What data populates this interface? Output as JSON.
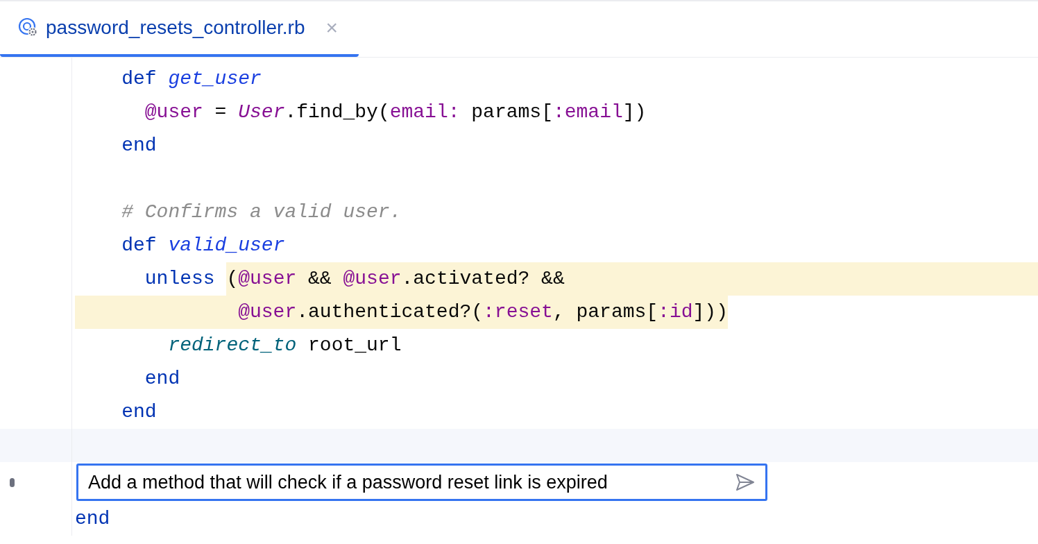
{
  "tabs": [
    {
      "label": "password_resets_controller.rb",
      "selected": true,
      "close": "×"
    }
  ],
  "code": [
    {
      "kind": "line",
      "tokens": [
        {
          "kind": "keyword",
          "text": "def "
        },
        {
          "kind": "method_name",
          "text": "get_user"
        }
      ],
      "children": [
        {
          "kind": "line",
          "tokens": [
            {
              "kind": "ivar",
              "text": "@user"
            },
            {
              "kind": "plain",
              "text": " = "
            },
            {
              "kind": "constant",
              "text": "User"
            },
            {
              "kind": "plain",
              "text": ".find_by("
            },
            {
              "kind": "symbol",
              "text": "email:"
            },
            {
              "kind": "plain",
              "text": " params["
            },
            {
              "kind": "symbol",
              "text": ":email"
            },
            {
              "kind": "plain",
              "text": "])"
            }
          ]
        }
      ]
    },
    {
      "kind": "line",
      "tokens": [
        {
          "kind": "keyword",
          "text": "end"
        }
      ]
    },
    {
      "kind": "blank"
    },
    {
      "kind": "line",
      "tokens": [
        {
          "kind": "comment",
          "text": "# Confirms a valid user."
        }
      ]
    },
    {
      "kind": "line",
      "tokens": [
        {
          "kind": "keyword",
          "text": "def "
        },
        {
          "kind": "method_name",
          "text": "valid_user"
        }
      ],
      "children": [
        {
          "kind": "line",
          "highlight_to_end": true,
          "tokens": [
            {
              "kind": "keyword",
              "text": "unless "
            },
            {
              "kind": "plain",
              "text": "(",
              "highlighted": true
            },
            {
              "kind": "ivar",
              "text": "@user",
              "highlighted": true
            },
            {
              "kind": "plain",
              "text": " && ",
              "highlighted": true
            },
            {
              "kind": "ivar",
              "text": "@user",
              "highlighted": true
            },
            {
              "kind": "plain",
              "text": ".activated? &&",
              "highlighted": true
            }
          ],
          "continuation": {
            "highlighted": true,
            "tokens": [
              {
                "kind": "ivar",
                "text": "@user"
              },
              {
                "kind": "plain",
                "text": ".authenticated?("
              },
              {
                "kind": "symbol",
                "text": ":reset"
              },
              {
                "kind": "plain",
                "text": ", params["
              },
              {
                "kind": "symbol",
                "text": ":id"
              },
              {
                "kind": "plain",
                "text": "]))"
              }
            ]
          },
          "children": [
            {
              "kind": "line",
              "tokens": [
                {
                  "kind": "call",
                  "text": "redirect_to"
                },
                {
                  "kind": "plain",
                  "text": " root_url"
                }
              ]
            }
          ]
        },
        {
          "kind": "line",
          "tokens": [
            {
              "kind": "keyword",
              "text": "end"
            }
          ]
        }
      ]
    },
    {
      "kind": "line",
      "tokens": [
        {
          "kind": "keyword",
          "text": "end"
        }
      ]
    },
    {
      "kind": "current_line"
    }
  ],
  "prompt": {
    "value": "Add a method that will check if a password reset link is expired"
  },
  "code_after": [
    {
      "kind": "line",
      "tokens": [
        {
          "kind": "keyword",
          "text": "end"
        }
      ]
    }
  ]
}
